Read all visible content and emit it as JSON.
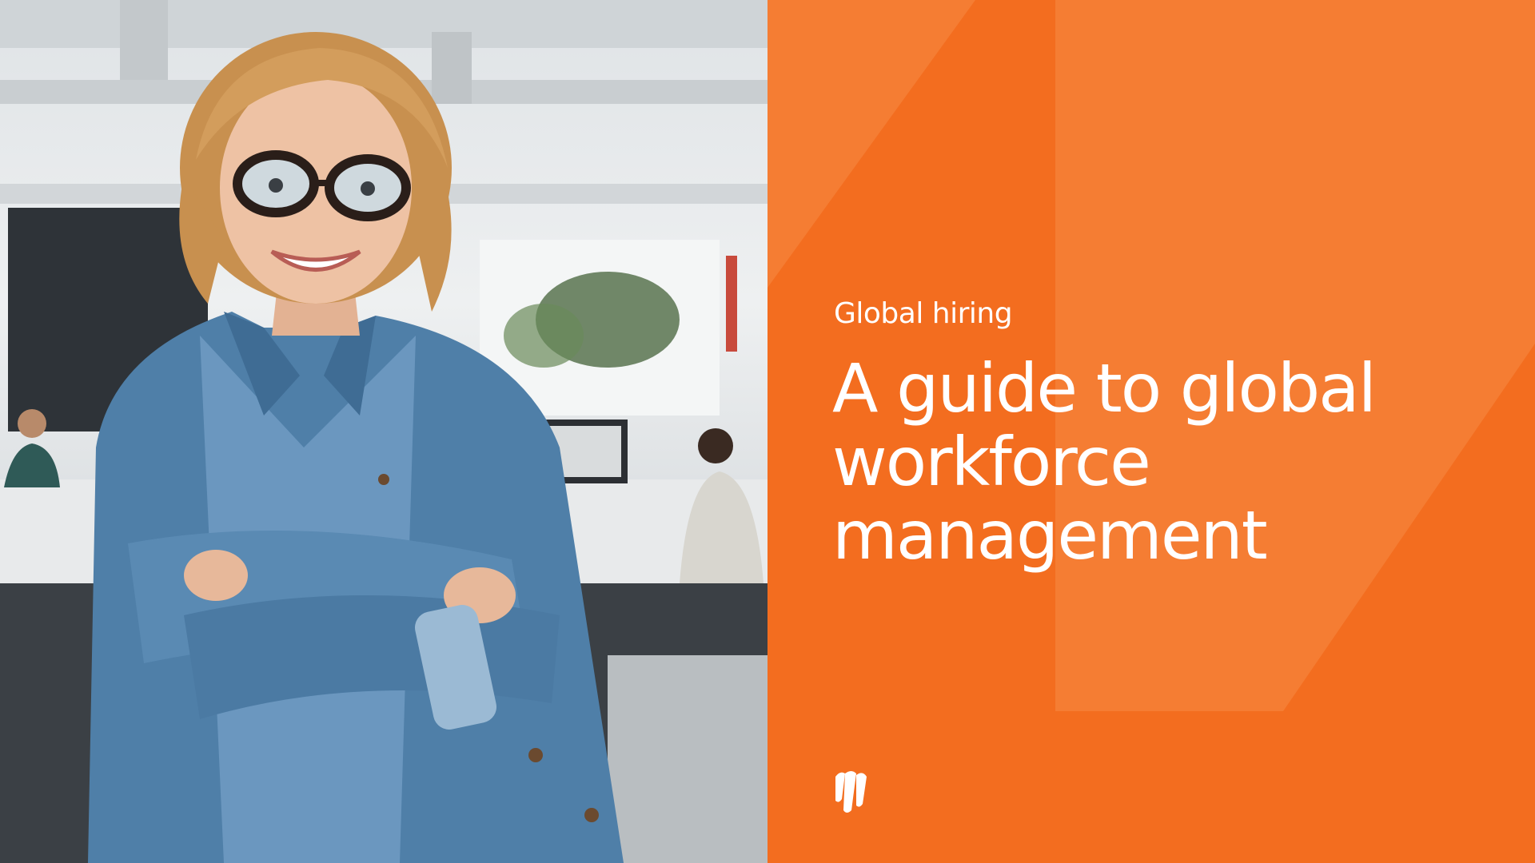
{
  "hero": {
    "eyebrow": "Global hiring",
    "headline_lines": [
      "A guide to global",
      "workforce",
      "management"
    ]
  },
  "icons": {
    "brand_logo": "brand-logo-icon"
  },
  "colors": {
    "accent_orange": "#f36d1f",
    "accent_orange_light": "#f57d33",
    "text_on_accent": "#ffffff"
  }
}
